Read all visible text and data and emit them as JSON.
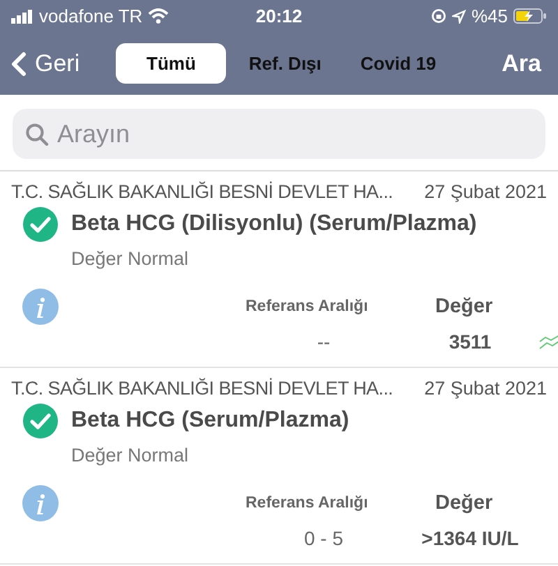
{
  "status_bar": {
    "carrier": "vodafone TR",
    "time": "20:12",
    "battery": "%45"
  },
  "nav": {
    "back": "Geri",
    "tabs": [
      {
        "label": "Tümü",
        "selected": true
      },
      {
        "label": "Ref. Dışı",
        "selected": false
      },
      {
        "label": "Covid 19",
        "selected": false
      }
    ],
    "action": "Ara"
  },
  "search": {
    "placeholder": "Arayın"
  },
  "results": [
    {
      "source": "T.C. SAĞLIK BAKANLIĞI BESNİ DEVLET HA...",
      "date": "27 Şubat 2021",
      "test": "Beta HCG (Dilisyonlu) (Serum/Plazma)",
      "status": "Değer Normal",
      "range_label": "Referans Aralığı",
      "value_label": "Değer",
      "range": "--",
      "value": "3511",
      "trend": true
    },
    {
      "source": "T.C. SAĞLIK BAKANLIĞI BESNİ DEVLET HA...",
      "date": "27 Şubat 2021",
      "test": "Beta HCG (Serum/Plazma)",
      "status": "Değer Normal",
      "range_label": "Referans Aralığı",
      "value_label": "Değer",
      "range": "0 - 5",
      "value": ">1364 IU/L",
      "trend": false
    }
  ]
}
